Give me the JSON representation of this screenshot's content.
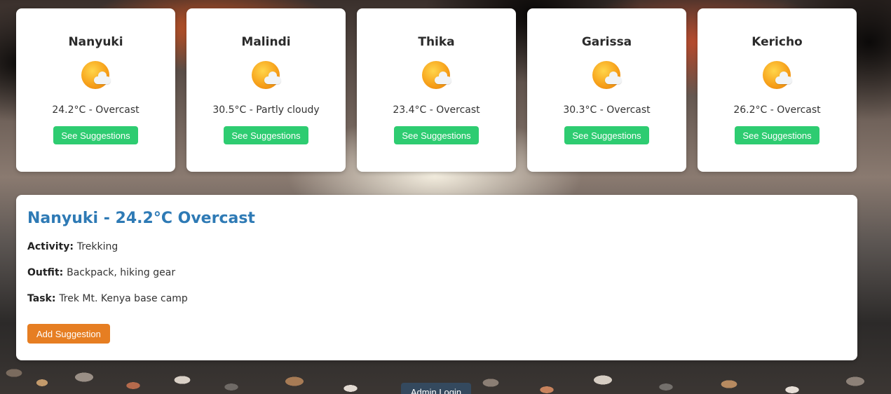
{
  "cities": [
    {
      "name": "Nanyuki",
      "weather": "24.2°C - Overcast",
      "button": "See Suggestions"
    },
    {
      "name": "Malindi",
      "weather": "30.5°C - Partly cloudy",
      "button": "See Suggestions"
    },
    {
      "name": "Thika",
      "weather": "23.4°C - Overcast",
      "button": "See Suggestions"
    },
    {
      "name": "Garissa",
      "weather": "30.3°C - Overcast",
      "button": "See Suggestions"
    },
    {
      "name": "Kericho",
      "weather": "26.2°C - Overcast",
      "button": "See Suggestions"
    }
  ],
  "icon": "sun-behind-cloud-icon",
  "detail": {
    "title": "Nanyuki - 24.2°C Overcast",
    "activity_label": "Activity:",
    "activity": "Trekking",
    "outfit_label": "Outfit:",
    "outfit": "Backpack, hiking gear",
    "task_label": "Task:",
    "task": "Trek Mt. Kenya base camp",
    "add_button": "Add Suggestion"
  },
  "admin_button": "Admin Login",
  "colors": {
    "title_blue": "#2e7ab5",
    "button_green": "#2ecc71",
    "button_orange": "#e67e22",
    "admin_navy": "#34495e"
  }
}
